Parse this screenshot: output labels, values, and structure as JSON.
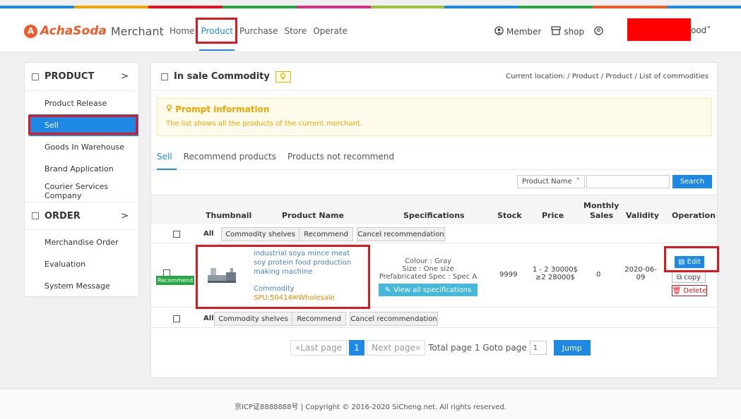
{
  "header": {
    "brand": "AchaSoda",
    "merchant": "Merchant",
    "nav": [
      "Home",
      "Product",
      "Purchase",
      "Store",
      "Operate"
    ],
    "member": "Member",
    "shop": "shop",
    "user_suffix": "ood"
  },
  "sidebar": {
    "product_title": "PRODUCT",
    "product_items": [
      "Product Release",
      "Sell",
      "Goods In Warehouse",
      "Brand Application",
      "Courier Services Company"
    ],
    "order_title": "ORDER",
    "order_items": [
      "Merchandise Order",
      "Evaluation",
      "System Message"
    ]
  },
  "main": {
    "title": "In sale Commodity",
    "crumb_label": "Current location:",
    "crumb": [
      "Product",
      "Product",
      "List of commodities"
    ],
    "prompt_title": "Prompt information",
    "prompt_text": "The list shows all the products of the current merchant.",
    "tabs": [
      "Sell",
      "Recommend products",
      "Products not recommend"
    ],
    "filter_select": "Product Name",
    "search_label": "Search"
  },
  "table": {
    "headers": {
      "thumbnail": "Thumbnail",
      "name": "Product Name",
      "spec": "Specifications",
      "stock": "Stock",
      "price": "Price",
      "sales_1": "Monthly",
      "sales_2": "Sales",
      "validity": "Validity",
      "operation": "Operation"
    },
    "bulk": {
      "all": "All",
      "shelves": "Commodity shelves",
      "recommend": "Recommend",
      "cancel": "Cancel recommendation"
    },
    "row": {
      "badge": "Recommend",
      "name": "industrial soya mince meat soy protein food production making machine",
      "category": "Commodity",
      "spu": "SPU:50414✉Wholesale",
      "spec_1": "Colour : Gray",
      "spec_2": "Size : One size",
      "spec_3": "Prefabricated Spec : Spec A",
      "spec_button": "View all specifications",
      "stock": "9999",
      "price_1": "1 - 2  30000$",
      "price_2": "≥2  28000$",
      "sales": "0",
      "validity_1": "2020-06-",
      "validity_2": "09",
      "edit": "Edit",
      "copy": "copy",
      "delete": "Delete"
    }
  },
  "pager": {
    "prev": "«Last page",
    "current": "1",
    "next": "Next page»",
    "total": "Total  page 1 Goto  page",
    "input": "1",
    "jump": "Jump"
  },
  "footer": "京ICP证8888888号  |  Copyright © 2016-2020 SiCheng.net. All rights reserved."
}
